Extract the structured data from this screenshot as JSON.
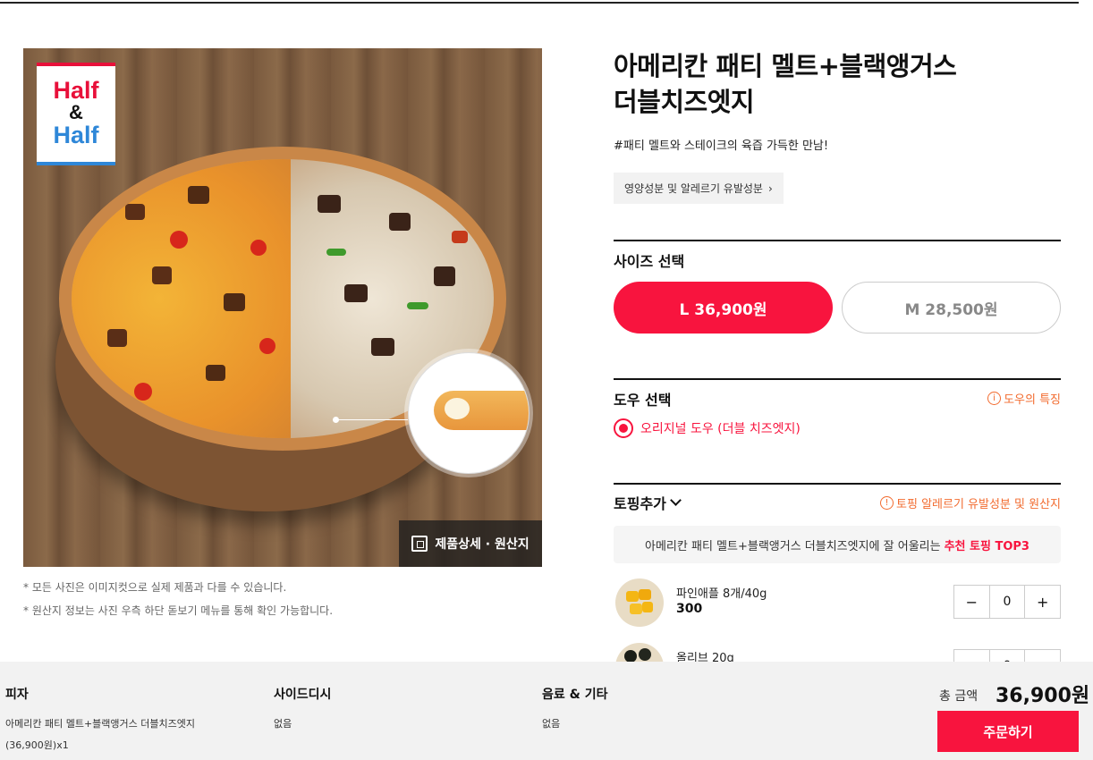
{
  "product": {
    "image_alt": "half & half pizza",
    "logo": {
      "line1": "Half",
      "line2": "&",
      "line3": "Half"
    },
    "detail_button": "제품상세 · 원산지",
    "notes": [
      "* 모든 사진은 이미지컷으로 실제 제품과 다를 수 있습니다.",
      "* 원산지 정보는 사진 우측 하단 돋보기 메뉴를 통해 확인 가능합니다."
    ],
    "title_line1": "아메리칸 패티 멜트+블랙앵거스",
    "title_line2": "더블치즈엣지",
    "subtitle": "#패티 멜트와 스테이크의 육즙 가득한 만남!",
    "nutrition_button": "영양성분 및 알레르기 유발성분"
  },
  "size": {
    "title": "사이즈 선택",
    "options": [
      {
        "label": "L 36,900원",
        "selected": true
      },
      {
        "label": "M 28,500원",
        "selected": false
      }
    ]
  },
  "dough": {
    "title": "도우 선택",
    "info_link": "도우의 특징",
    "option": "오리지널 도우 (더블 치즈엣지)"
  },
  "topping": {
    "title": "토핑추가",
    "info_link": "토핑 알레르기 유발성분 및 원산지",
    "reco_prefix": "아메리칸 패티 멜트+블랙앵거스 더블치즈엣지에 잘 어울리는",
    "reco_highlight": "추천 토핑 TOP3",
    "items": [
      {
        "name": "파인애플 8개/40g",
        "price": "300",
        "qty": "0"
      },
      {
        "name": "올리브 20g",
        "price": "",
        "qty": "0"
      }
    ]
  },
  "footer": {
    "pizza_label": "피자",
    "pizza_value_1": "아메리칸 패티 멜트+블랙앵거스 더블치즈엣지",
    "pizza_value_2": "(36,900원)x1",
    "side_label": "사이드디시",
    "side_value": "없음",
    "drink_label": "음료 & 기타",
    "drink_value": "없음",
    "total_label": "총 금액",
    "total_value": "36,900원",
    "order_button": "주문하기"
  },
  "colors": {
    "accent": "#f8143e",
    "link": "#f26b2f"
  }
}
